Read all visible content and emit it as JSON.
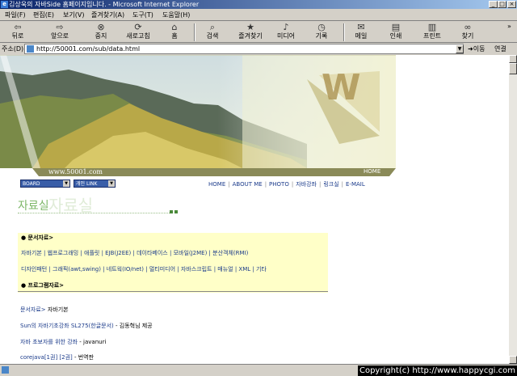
{
  "window": {
    "title": "김상욱의 자바Side 홈페이지입니다. - Microsoft Internet Explorer",
    "controls": [
      "_",
      "□",
      "×"
    ]
  },
  "menu": [
    "파일(F)",
    "편집(E)",
    "보기(V)",
    "즐겨찾기(A)",
    "도구(T)",
    "도움말(H)"
  ],
  "toolbar": {
    "back": "뒤로",
    "forward": "앞으로",
    "stop": "중지",
    "refresh": "새로고침",
    "home": "홈",
    "search": "검색",
    "favorites": "즐겨찾기",
    "media": "미디어",
    "history": "기록",
    "mail": "메일",
    "print": "인쇄",
    "print2": "프린트",
    "find": "찾기"
  },
  "address": {
    "label": "주소(D)",
    "url": "http://50001.com/sub/data.html",
    "go": "이동",
    "links": "연결"
  },
  "page": {
    "site_url": "www.50001.com",
    "home_tag": "HOME",
    "board_select": "BOARD",
    "personal_select": "개인 LINK",
    "nav": [
      "HOME",
      "ABOUT ME",
      "PHOTO",
      "자바강좌",
      "링크실",
      "E-MAIL"
    ],
    "section_title": "자료실",
    "section_title_bg": "자료실",
    "docs_header": "● 문서자료>",
    "categories_row1": [
      "자바기본",
      "웹프로그래밍",
      "애플릿",
      "EJB(J2EE)",
      "데이타베이스",
      "모바일(J2ME)",
      "분산객체(RMI)"
    ],
    "categories_row2": [
      "디자인패턴",
      "그래픽(awt,swing)",
      "네트웍(IO/net)",
      "멀티미디어",
      "자바스크립트",
      "매뉴얼",
      "XML",
      "기타"
    ],
    "program_header": "● 프로그램자료>",
    "breadcrumb_link": "문서자료>",
    "breadcrumb_rest": " 자바기본",
    "entries": [
      {
        "link": "Sun의 자바기초강좌 SL275(한글문서)",
        "rest": " - 김동혁님 제공"
      },
      {
        "link": "자바 초보자를 위한 강좌",
        "rest": " - javanuri"
      },
      {
        "link": "corejava[1권] [2권]",
        "rest": " - 번역판"
      }
    ]
  },
  "status": {
    "copyright": "Copyright(c) http://www.happycgi.com"
  },
  "colors": {
    "title_gradient_start": "#0a246a",
    "link": "#1a3a8a",
    "highlight_box": "#ffffc8",
    "section_title": "#7fb86a"
  }
}
